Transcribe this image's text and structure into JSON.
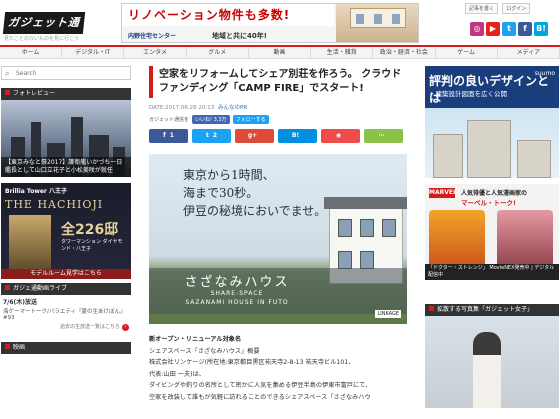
{
  "header": {
    "logo_text": "ガジェット通信",
    "tagline": "見たことのないものを見に行こう",
    "links": [
      "記事を書く",
      "ログイン"
    ],
    "banner": {
      "headline": "リノベーション物件も多数!",
      "brand": "内野住宅センター",
      "slogan": "地域と共に40年!"
    },
    "social": [
      {
        "name": "instagram-icon",
        "glyph": "◎",
        "color": "#c13584"
      },
      {
        "name": "youtube-icon",
        "glyph": "▶",
        "color": "#e62117"
      },
      {
        "name": "twitter-icon",
        "glyph": "t",
        "color": "#1da1f2"
      },
      {
        "name": "facebook-icon",
        "glyph": "f",
        "color": "#3b5998"
      },
      {
        "name": "hatena-icon",
        "glyph": "B!",
        "color": "#00a4de"
      }
    ]
  },
  "nav": [
    "ホーム",
    "デジタル・IT",
    "エンタメ",
    "グルメ",
    "動画",
    "生活・雑貨",
    "政治・経済・社会",
    "ゲーム",
    "メディア"
  ],
  "search": {
    "placeholder": "Search"
  },
  "left": {
    "photo_review_title": "フォトレビュー",
    "photo_caption": "【東京みなと祭2017】護衛艦いかづち一日艦長として山口立花子と小松美咲が就任",
    "ad": {
      "brand": "Brillia Tower 八王子",
      "title": "THE HACHIOJI",
      "units": "全226邸",
      "sub": "タワーマンション ダイヤモンド・八王子",
      "bottom": "モデルルーム見学はこちら"
    },
    "live": {
      "title": "ガジェ通動画ライブ",
      "date": "7/6(木)放送",
      "program": "海ゲーマートーク/バラエティ『夏の生あけぼん』#93",
      "more": "過去の生放送一覧はこちら"
    },
    "video_title": "映画"
  },
  "article": {
    "title": "空家をリフォームしてシェア別荘を作ろう。 クラウドファンディング「CAMP FIRE」でスタート!",
    "date": "DATE:2017.06.28 20:13",
    "category": "みんなのPR",
    "shares_label": "ガジェット通信を",
    "like_pill": "いいね! 3.3万",
    "follow_pill": "フォローする",
    "share_counts": [
      "1",
      "2",
      "",
      "",
      "",
      ""
    ],
    "share_glyphs": [
      "f",
      "t",
      "g+",
      "B!",
      "◉",
      "⋯"
    ],
    "share_colors": [
      "#3b5998",
      "#1da1f2",
      "#dd4b39",
      "#008fde",
      "#f04b4b",
      "#8bc34a"
    ],
    "hero": {
      "line1": "東京から1時間、",
      "line2": "海まで30秒。",
      "line3": "伊豆の秘境においでませ。",
      "name": "さざなみハウス",
      "sub1": "SHARE-SPACE",
      "sub2": "SAZANAMI HOUSE IN FUTO",
      "badge": "LINKAGE"
    },
    "body": {
      "heading": "新オープン・リニューアル対象名",
      "l1": "シェアスペース「さざなみハウス」概要",
      "l2": "株式会社リンケージ(所在地:東京都目黒区祐天寺2-8-13 祐天寺ビル101、",
      "l3": "代表:山田 一夫)は、",
      "l4": "ダイビングや釣りの名所として密かに人気を集める伊豆半島の伊東市富戸にて、",
      "l5": "空家を改装して誰もが気軽に訪れることのできるシェアスペース「さざなみハウ"
    }
  },
  "right": {
    "suumo": {
      "headline": "評判の良いデザインとは",
      "sub": "・建築設計図面を広く公開",
      "logo": "suumo"
    },
    "marvel": {
      "logo": "MARVEL",
      "line1": "人気俳優と人気漫画家の",
      "line2": "マーベル・トーク!",
      "strip": "「ドクター・ストレンジ」 MovieNEX発売中 | デジタル配信中"
    },
    "girls_title": "拡散する写真集「ガジェット女子」"
  }
}
